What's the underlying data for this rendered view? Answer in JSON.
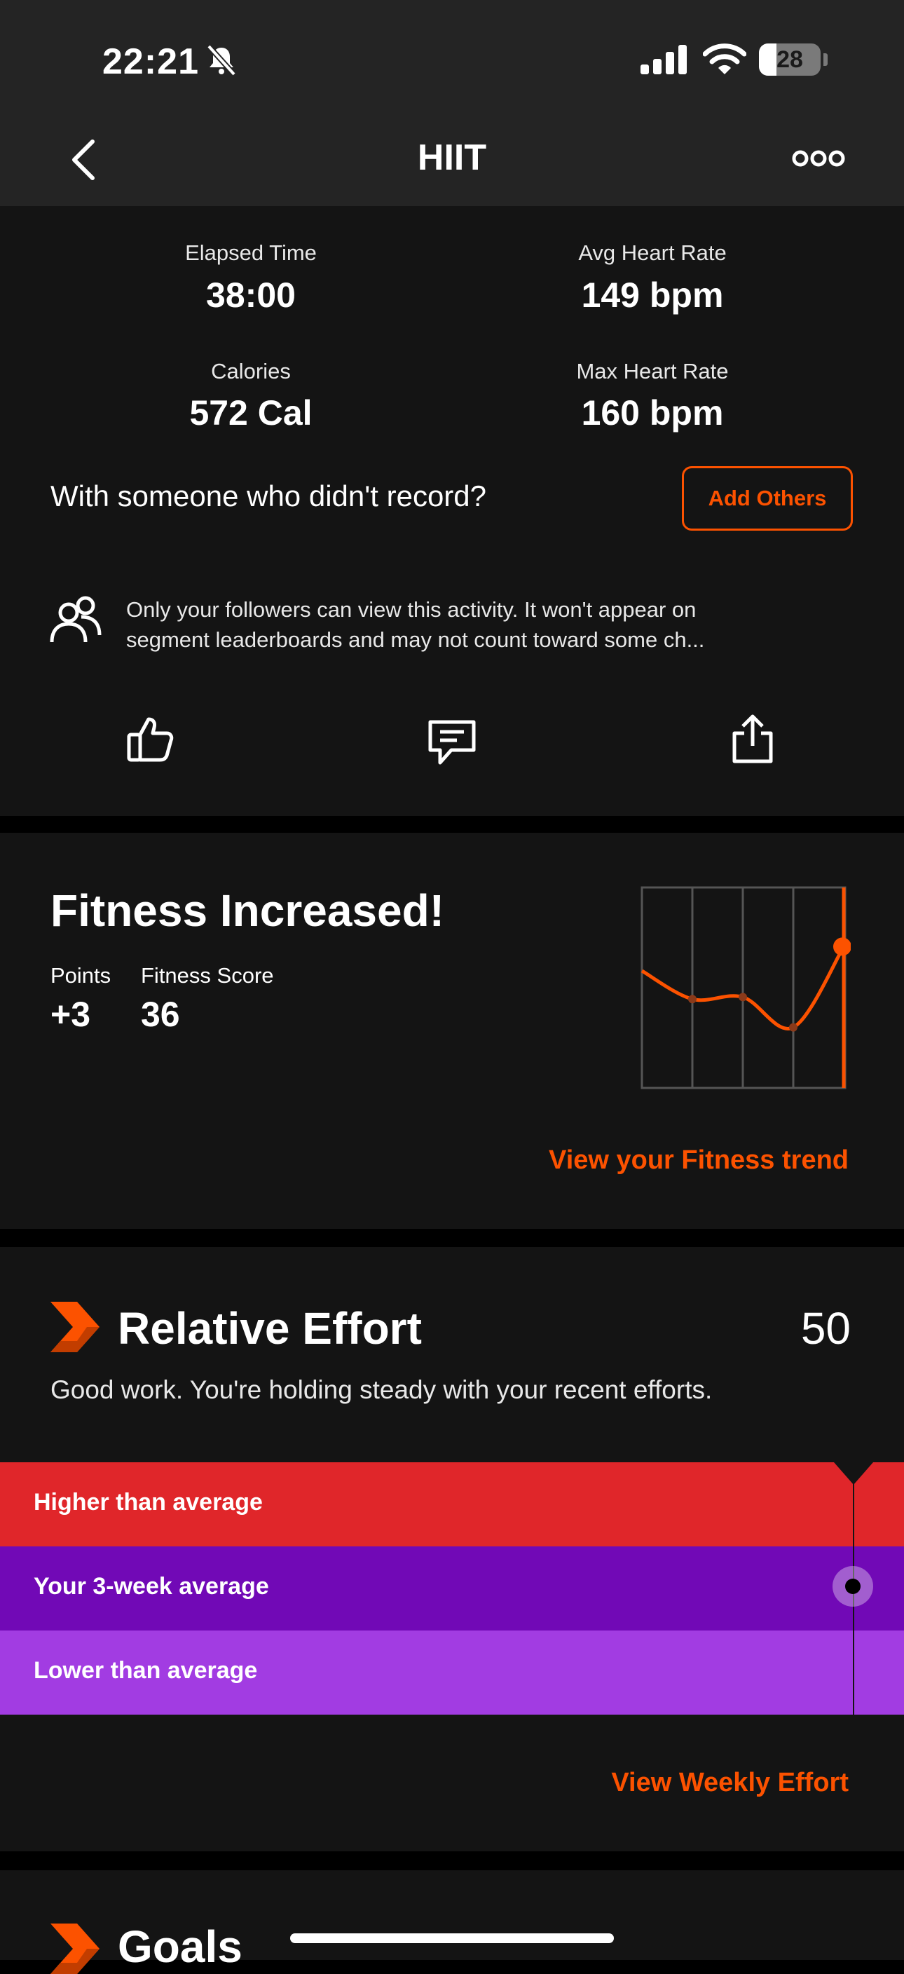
{
  "status_bar": {
    "time": "22:21",
    "battery": "28",
    "icons": [
      "bell-slash-icon",
      "signal-icon",
      "wifi-icon",
      "battery-icon"
    ]
  },
  "nav": {
    "title": "HIIT",
    "back_icon": "chevron-left-icon",
    "more_icon": "more-icon"
  },
  "stats": {
    "elapsed_label": "Elapsed Time",
    "elapsed_value": "38:00",
    "avg_hr_label": "Avg Heart Rate",
    "avg_hr_value": "149 bpm",
    "calories_label": "Calories",
    "calories_value": "572 Cal",
    "max_hr_label": "Max Heart Rate",
    "max_hr_value": "160 bpm"
  },
  "with_others": {
    "question": "With someone who didn't record?",
    "button": "Add Others"
  },
  "privacy": {
    "line1": "Only your followers can view this activity. It won't appear on",
    "line2": "segment leaderboards and may not count toward some ch..."
  },
  "actions": [
    "like-icon",
    "comment-icon",
    "share-icon"
  ],
  "fitness": {
    "title": "Fitness Increased!",
    "points_label": "Points",
    "points_value": "+3",
    "score_label": "Fitness Score",
    "score_value": "36",
    "link": "View your Fitness trend",
    "trend_points": [
      0.58,
      0.44,
      0.45,
      0.3,
      0.7
    ]
  },
  "relative_effort": {
    "title": "Relative Effort",
    "score": "50",
    "description": "Good work. You're holding steady with your recent efforts.",
    "bands": [
      {
        "label": "Higher than average",
        "color": "#e0262a"
      },
      {
        "label": "Your 3-week average",
        "color": "#7109b6"
      },
      {
        "label": "Lower than average",
        "color": "#a23ce2"
      }
    ],
    "link": "View Weekly Effort"
  },
  "goals": {
    "title": "Goals"
  },
  "colors": {
    "accent": "#fc5200",
    "card": "#141414",
    "bar": "#242424"
  }
}
